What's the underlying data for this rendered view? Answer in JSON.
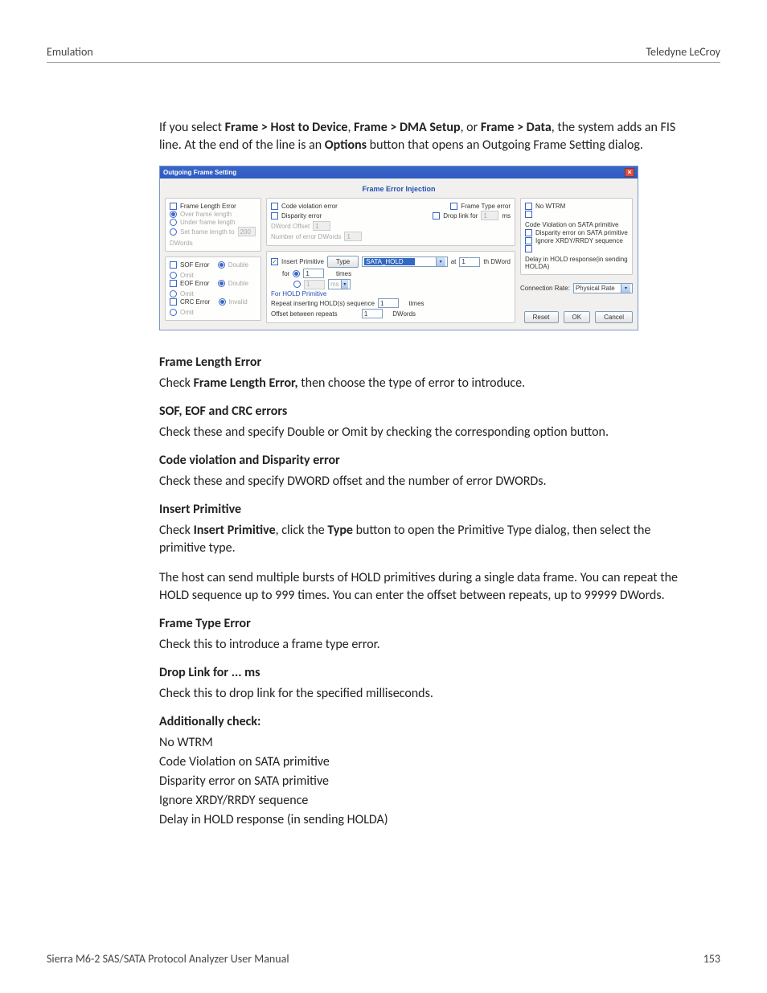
{
  "header": {
    "left": "Emulation",
    "right": "Teledyne LeCroy"
  },
  "footer": {
    "left": "Sierra M6-2 SAS/SATA Protocol Analyzer User Manual",
    "right": "153"
  },
  "intro": {
    "pre": "If you select ",
    "b1": "Frame > Host to Device",
    "mid1": ", ",
    "b2": "Frame > DMA Setup",
    "mid2": ", or ",
    "b3": "Frame > Data",
    "post1": ", the system adds an FIS line. At the end of the line is an ",
    "b4": "Options",
    "post2": " button that opens an Outgoing Frame Setting dialog."
  },
  "dialog": {
    "title": "Outgoing Frame Setting",
    "close": "×",
    "subtitle": "Frame Error Injection",
    "left": {
      "frame_length_error": "Frame Length Error",
      "over": "Over frame length",
      "under": "Under frame length",
      "set_pre": "Set frame length to",
      "set_val": "200",
      "dwords": "DWords",
      "sof": "SOF Error",
      "eof": "EOF Error",
      "crc": "CRC Error",
      "double": "Double",
      "omit": "Omit",
      "invalid": "Invalid"
    },
    "mid": {
      "code": "Code violation error",
      "disp": "Disparity error",
      "dword_off": "DWord Offset",
      "num_err": "Number of error DWords",
      "one": "1",
      "ftype": "Frame Type error",
      "droplink": "Drop link for",
      "ms": "ms",
      "insert_prim": "Insert Primitive",
      "type_btn": "Type",
      "sata_hold": "SATA_HOLD",
      "at": "at",
      "thdword": "th DWord",
      "for": "for",
      "times": "times",
      "forhold": "For HOLD Primitive",
      "repeat": "Repeat inserting HOLD(s) sequence",
      "offset": "Offset between repeats",
      "dwords": "DWords",
      "msunit": "ms"
    },
    "right": {
      "nowtrm": "No WTRM",
      "codesata": "Code Violation on SATA primitive",
      "dispsata": "Disparity error on SATA primitive",
      "ignxrdy": "Ignore XRDY/RRDY sequence",
      "delayhold": "Delay in HOLD response(in sending HOLDA)",
      "connrate": "Connection Rate:",
      "physrate": "Physical Rate",
      "reset": "Reset",
      "ok": "OK",
      "cancel": "Cancel"
    }
  },
  "sections": {
    "fle_h": "Frame Length Error",
    "fle_p_pre": "Check ",
    "fle_p_b": "Frame Length Error,",
    "fle_p_post": " then choose the type of error to introduce.",
    "sec_h": "SOF, EOF and CRC errors",
    "sec_p": "Check these and specify Double or Omit by checking the corresponding option button.",
    "cve_h": "Code violation and Disparity error",
    "cve_p": "Check these and specify DWORD offset and the number of error DWORDs.",
    "ip_h": "Insert Primitive",
    "ip_p_pre": "Check ",
    "ip_p_b1": "Insert Primitive",
    "ip_p_mid": ", click the ",
    "ip_p_b2": "Type",
    "ip_p_post": " button to open the Primitive Type dialog, then select the primitive type.",
    "ip_p2": "The host can send multiple bursts of HOLD primitives during a single data frame. You can repeat the HOLD sequence up to 999 times. You can enter the offset between repeats, up to 99999 DWords.",
    "fte_h": "Frame Type Error",
    "fte_p": "Check this to introduce a frame type error.",
    "dl_h": "Drop Link for ... ms",
    "dl_p": "Check this to drop link for the specified milliseconds.",
    "add_h": "Additionally check:",
    "add_l1": "No WTRM",
    "add_l2": "Code Violation on SATA primitive",
    "add_l3": "Disparity error on SATA primitive",
    "add_l4": "Ignore XRDY/RRDY sequence",
    "add_l5": "Delay in HOLD response (in sending HOLDA)"
  }
}
